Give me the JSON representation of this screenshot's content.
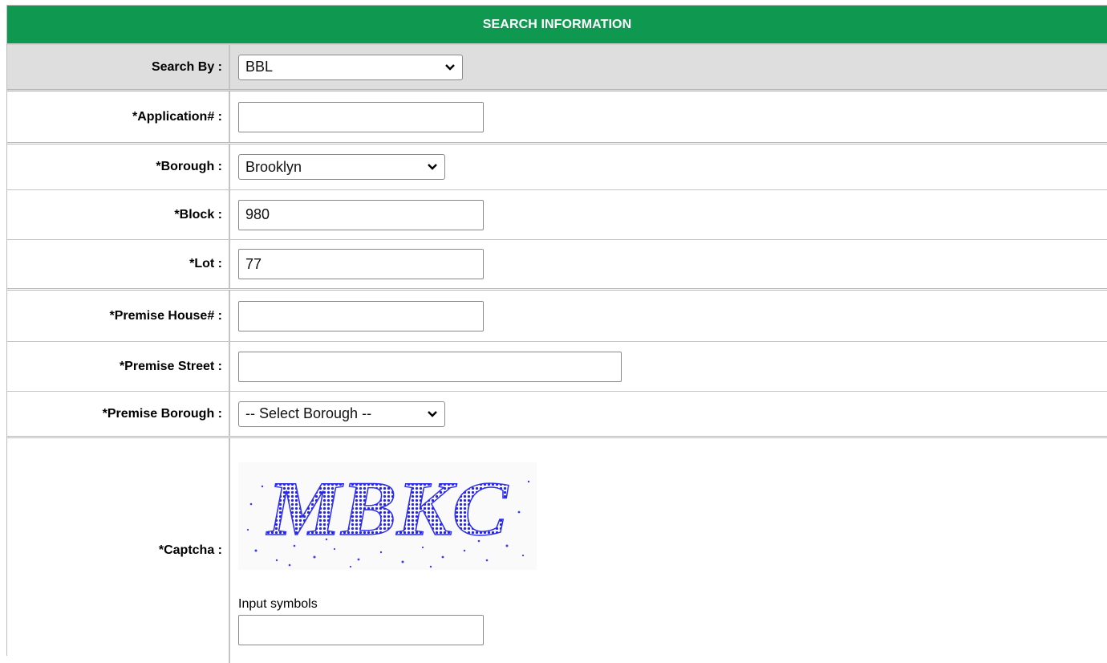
{
  "header": {
    "title": "SEARCH INFORMATION"
  },
  "fields": {
    "search_by": {
      "label": "Search By :",
      "value": "BBL"
    },
    "application": {
      "label": "*Application# :",
      "value": ""
    },
    "borough": {
      "label": "*Borough :",
      "value": "Brooklyn"
    },
    "block": {
      "label": "*Block :",
      "value": "980"
    },
    "lot": {
      "label": "*Lot :",
      "value": "77"
    },
    "premise_house": {
      "label": "*Premise House# :",
      "value": ""
    },
    "premise_street": {
      "label": "*Premise Street :",
      "value": ""
    },
    "premise_borough": {
      "label": "*Premise Borough :",
      "value": "-- Select Borough --"
    },
    "captcha": {
      "label": "*Captcha :",
      "image_text": "MBKC",
      "input_label": "Input symbols",
      "value": ""
    }
  },
  "colors": {
    "header_bg": "#0f9850",
    "row_gray": "#dedede",
    "captcha_text": "#2424e6"
  },
  "icons": {
    "select_arrow": "chevron-down-icon"
  }
}
